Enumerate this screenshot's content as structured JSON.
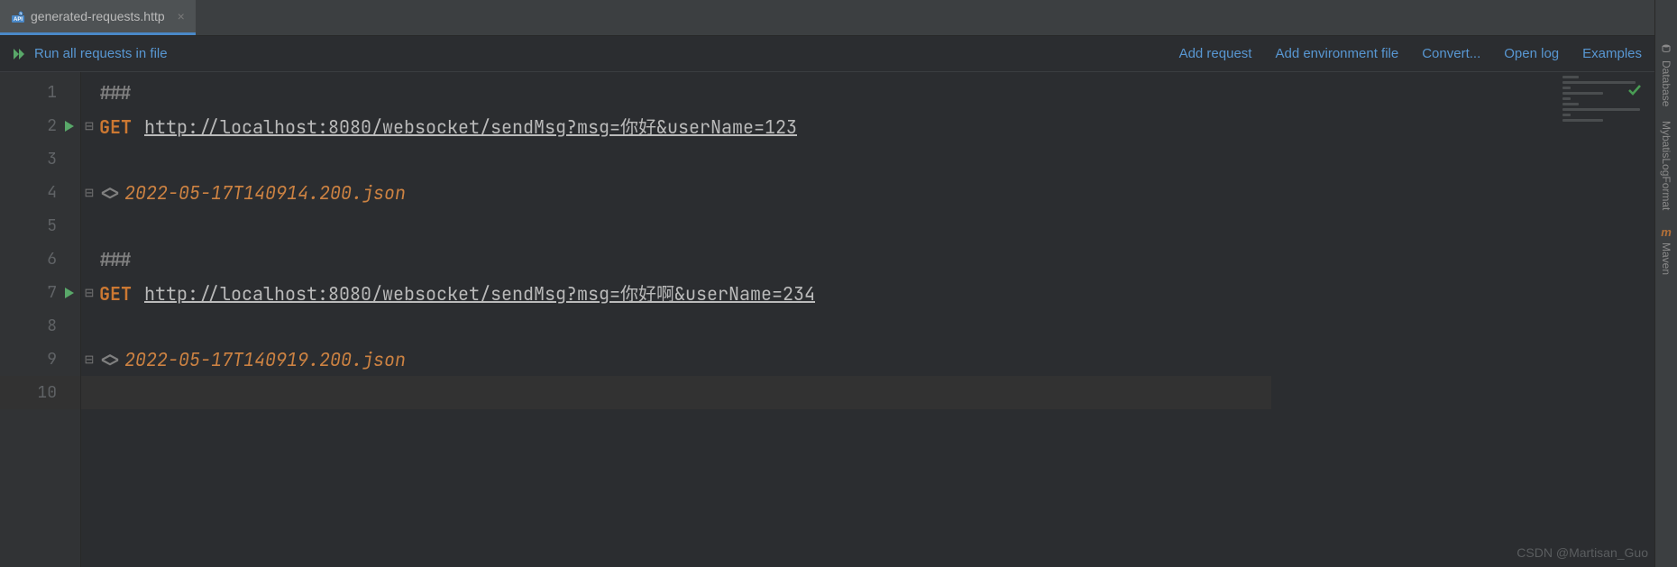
{
  "tab": {
    "filename": "generated-requests.http"
  },
  "toolbar": {
    "run_all": "Run all requests in file",
    "actions": [
      "Add request",
      "Add environment file",
      "Convert...",
      "Open log",
      "Examples"
    ]
  },
  "code": {
    "lines": [
      {
        "n": 1,
        "type": "sep",
        "text": "###"
      },
      {
        "n": 2,
        "type": "request",
        "method": "GET",
        "url": "http://localhost:8080/websocket/sendMsg?msg=你好&userName=123",
        "runnable": true
      },
      {
        "n": 3,
        "type": "blank"
      },
      {
        "n": 4,
        "type": "response",
        "marker": "<>",
        "file": "2022-05-17T140914.200.json"
      },
      {
        "n": 5,
        "type": "blank"
      },
      {
        "n": 6,
        "type": "sep",
        "text": "###"
      },
      {
        "n": 7,
        "type": "request",
        "method": "GET",
        "url": "http://localhost:8080/websocket/sendMsg?msg=你好啊&userName=234",
        "runnable": true
      },
      {
        "n": 8,
        "type": "blank"
      },
      {
        "n": 9,
        "type": "response",
        "marker": "<>",
        "file": "2022-05-17T140919.200.json"
      },
      {
        "n": 10,
        "type": "blank",
        "current": true
      }
    ]
  },
  "sidebar": {
    "items": [
      "Database",
      "MybatisLogFormat",
      "Maven"
    ]
  },
  "watermark": "CSDN @Martisan_Guo"
}
